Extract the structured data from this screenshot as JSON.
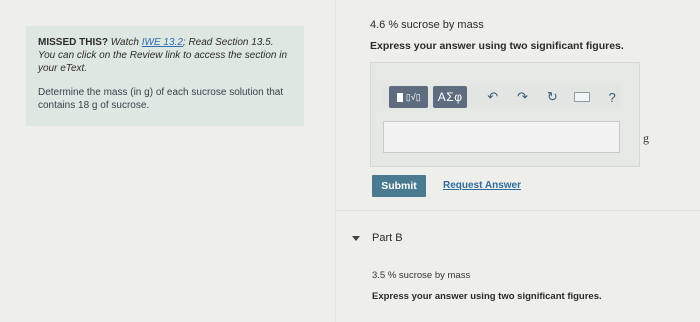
{
  "hint": {
    "missed_label": "MISSED THIS?",
    "watch_text": "Watch",
    "iwe_link": "IWE 13.2",
    "read_section_text": "; Read Section 13.5. You can click on the Review link to access the section in your eText.",
    "question": "Determine the mass (in g) of each sucrose solution that contains 18  g of sucrose."
  },
  "part_a": {
    "concentration": "4.6 % sucrose by mass",
    "instruction": "Express your answer using two significant figures.",
    "toolbar": {
      "templates_icon": "templates-icon",
      "greek_label": "ΑΣφ",
      "undo_icon": "undo-icon",
      "redo_icon": "redo-icon",
      "reset_icon": "reset-icon",
      "keyboard_icon": "keyboard-icon",
      "help_label": "?"
    },
    "input_value": "",
    "unit": "g",
    "submit_label": "Submit",
    "request_answer_label": "Request Answer"
  },
  "part_b": {
    "label": "Part B",
    "concentration": "3.5 % sucrose by mass",
    "instruction": "Express your answer using two significant figures."
  }
}
